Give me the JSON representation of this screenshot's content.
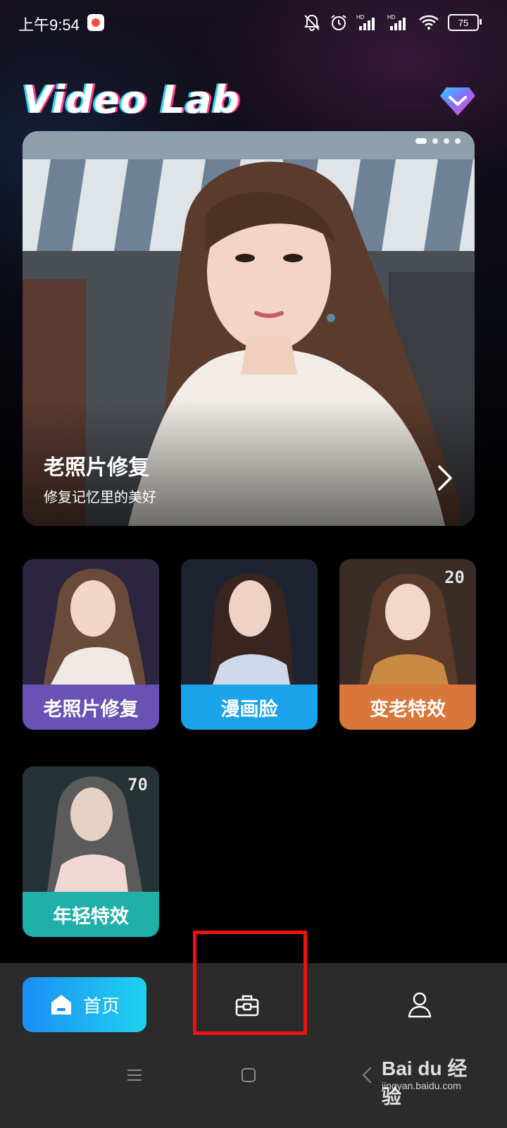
{
  "status_bar": {
    "time": "上午9:54",
    "battery": "75",
    "icons": [
      "recording-icon",
      "bell-muted-icon",
      "alarm-icon",
      "signal-hd-icon",
      "signal-hd-icon",
      "wifi-icon",
      "battery-icon"
    ]
  },
  "header": {
    "title": "Video Lab",
    "premium_icon": "diamond-icon"
  },
  "banner": {
    "title": "老照片修复",
    "subtitle": "修复记忆里的美好",
    "page_count": 4,
    "active_page": 1,
    "arrow_icon": "chevron-right-icon"
  },
  "features": [
    {
      "label": "老照片修复",
      "badge": "",
      "color": "#6a52b5"
    },
    {
      "label": "漫画脸",
      "badge": "",
      "color": "#1aa3ea"
    },
    {
      "label": "变老特效",
      "badge": "20",
      "color": "#d9773a"
    },
    {
      "label": "年轻特效",
      "badge": "70",
      "color": "#1fb0a8"
    }
  ],
  "bottom_nav": {
    "home_label": "首页",
    "home_icon": "home-icon",
    "tools_icon": "toolbox-icon",
    "profile_icon": "user-icon",
    "active": "home"
  },
  "colors": {
    "home_gradient_start": "#1b8ef5",
    "home_gradient_end": "#1fd2f0",
    "highlight": "#ee1111",
    "nav_background": "#2b2b2b"
  },
  "watermark": {
    "brand": "Bai du 经验",
    "url": "jingyan.baidu.com"
  }
}
